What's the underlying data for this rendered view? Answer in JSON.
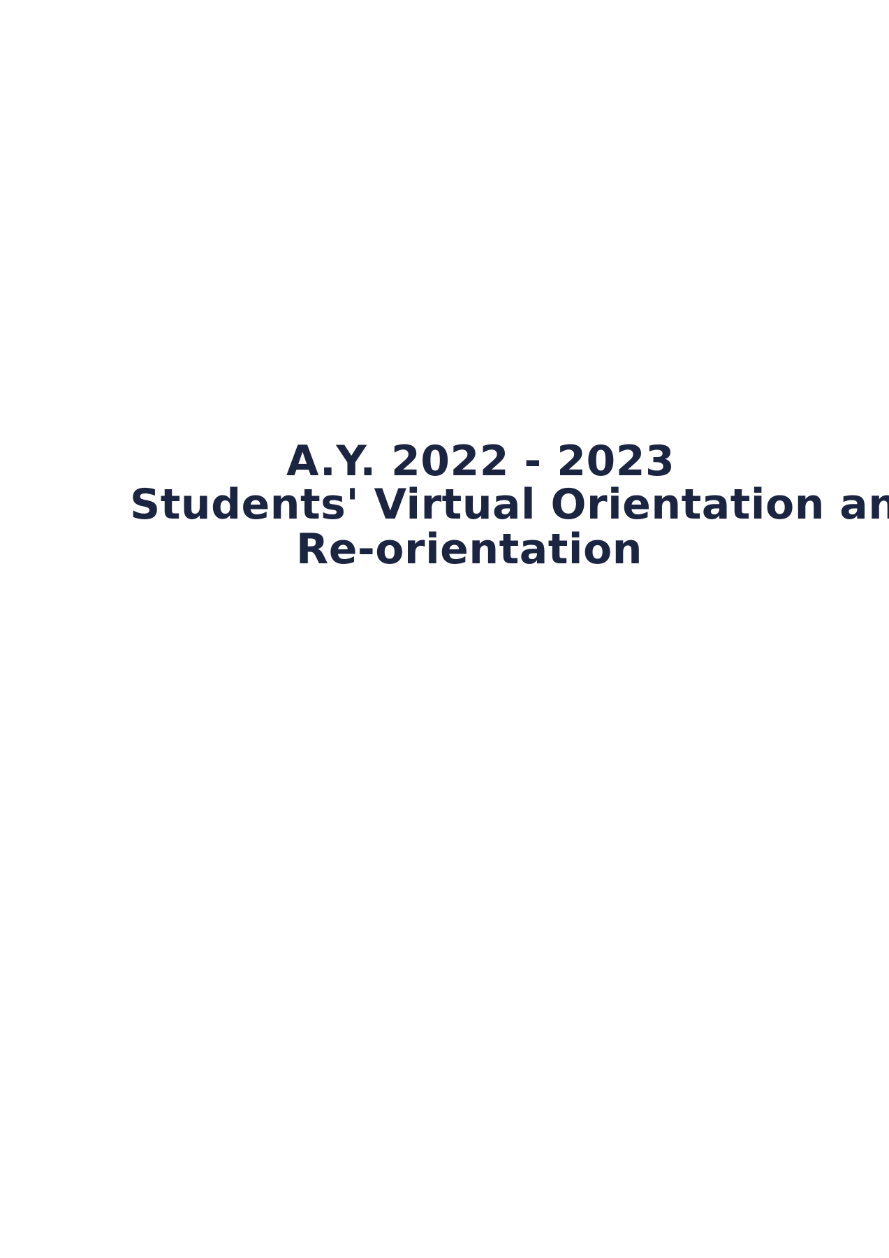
{
  "document": {
    "lines": [
      "A.Y. 2022 - 2023",
      "Students' Virtual Orientation and",
      "Re-orientation"
    ],
    "text_color": "#1b2440",
    "background_color": "#ffffff"
  }
}
